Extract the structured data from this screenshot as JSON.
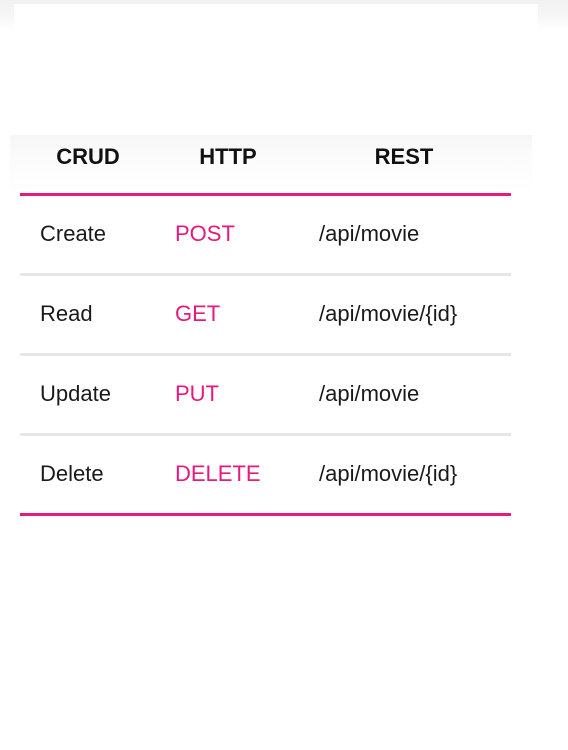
{
  "table": {
    "headers": {
      "crud": "CRUD",
      "http": "HTTP",
      "rest": "REST"
    },
    "rows": [
      {
        "operation": "Create",
        "method": "POST",
        "endpoint": "/api/movie"
      },
      {
        "operation": "Read",
        "method": "GET",
        "endpoint": "/api/movie/{id}"
      },
      {
        "operation": "Update",
        "method": "PUT",
        "endpoint": "/api/movie"
      },
      {
        "operation": "Delete",
        "method": "DELETE",
        "endpoint": "/api/movie/{id}"
      }
    ]
  },
  "colors": {
    "accent": "#e5197e",
    "divider": "#e6e6e6",
    "text": "#1a1a1a"
  }
}
